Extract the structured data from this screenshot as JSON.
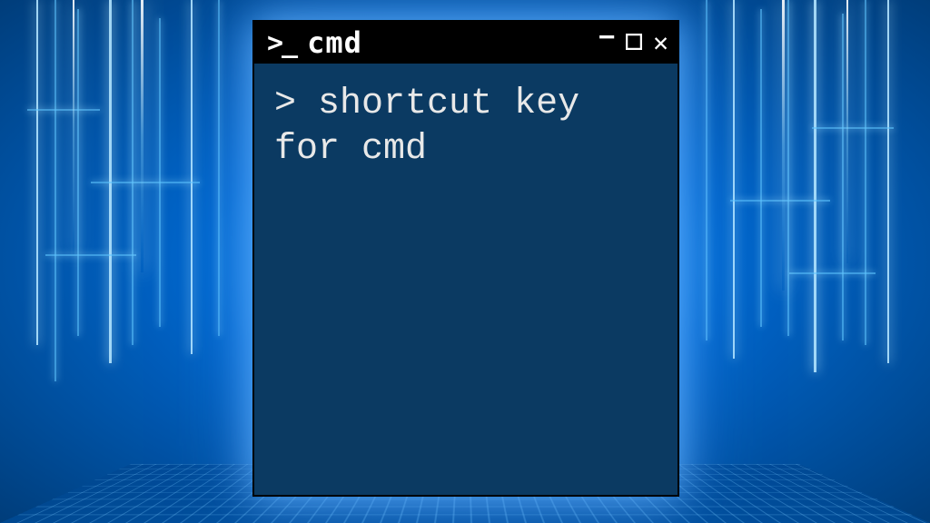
{
  "window": {
    "icon_text": ">_",
    "title": "cmd"
  },
  "terminal": {
    "prompt": ">",
    "command": "shortcut key for cmd"
  }
}
